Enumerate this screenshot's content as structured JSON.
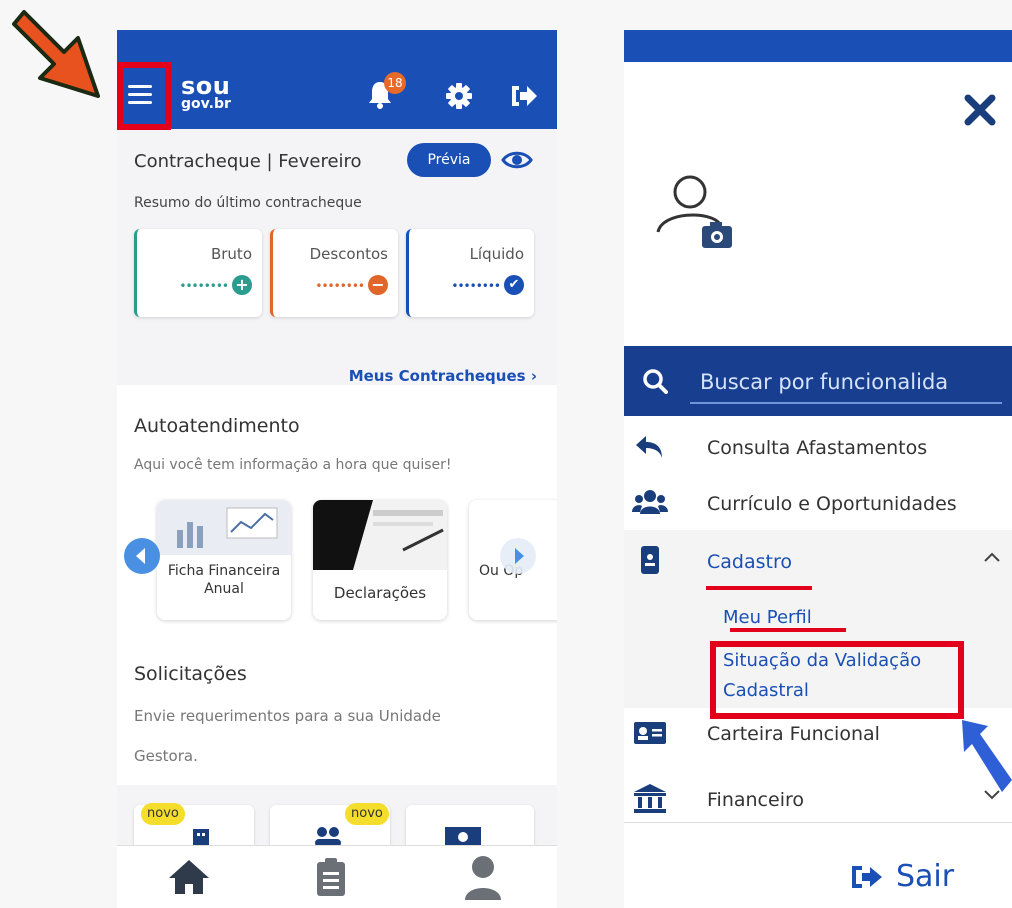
{
  "left_app": {
    "logo_line1": "sou",
    "logo_line2": "gov.br",
    "notification_count": "18",
    "contracheque_title": "Contracheque | Fevereiro",
    "previa_label": "Prévia",
    "contracheque_subtitle": "Resumo do último contracheque",
    "summary": [
      {
        "label": "Bruto",
        "dots": "••••••••",
        "icon": "plus-icon",
        "color": "#2a9d8f"
      },
      {
        "label": "Descontos",
        "dots": "••••••••",
        "icon": "minus-icon",
        "color": "#e0662a"
      },
      {
        "label": "Líquido",
        "dots": "••••••••",
        "icon": "check-icon",
        "color": "#1a4fb5"
      }
    ],
    "meus_contracheques": "Meus Contracheques",
    "autoatendimento_title": "Autoatendimento",
    "autoatendimento_subtitle": "Aqui você tem informação a hora que quiser!",
    "tiles": [
      "Ficha Financeira Anual",
      "Declarações",
      "Ou Op"
    ],
    "solicitacoes_title": "Solicitações",
    "solicitacoes_subtitle_1": "Envie requerimentos para a sua Unidade",
    "solicitacoes_subtitle_2": "Gestora.",
    "novo_badge": "novo"
  },
  "right_menu": {
    "search_placeholder": "Buscar por funcionalida",
    "items": [
      {
        "label": "Consulta Afastamentos",
        "icon": "return-arrow-icon"
      },
      {
        "label": "Currículo e Oportunidades",
        "icon": "users-icon"
      },
      {
        "label": "Cadastro",
        "icon": "id-badge-icon"
      },
      {
        "label": "Carteira Funcional",
        "icon": "id-card-icon"
      },
      {
        "label": "Financeiro",
        "icon": "bank-icon"
      }
    ],
    "cadastro_sub": [
      "Meu Perfil",
      "Situação da Validação Cadastral"
    ],
    "logout_label": "Sair"
  },
  "colors": {
    "brand_blue": "#1a4fb5",
    "annotation_red": "#e3001b",
    "annotation_orange": "#e8521e",
    "annotation_blue": "#2f5fd6"
  }
}
